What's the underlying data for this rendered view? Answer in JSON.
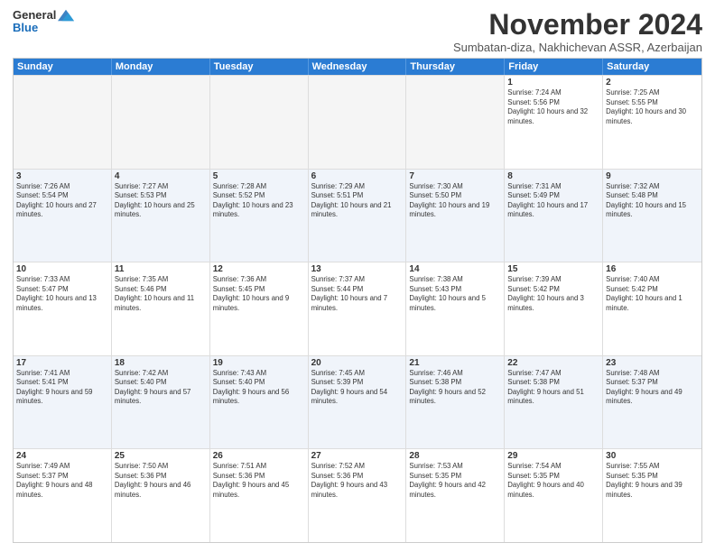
{
  "header": {
    "logo_line1": "General",
    "logo_line2": "Blue",
    "month_title": "November 2024",
    "subtitle": "Sumbatan-diza, Nakhichevan ASSR, Azerbaijan"
  },
  "days_of_week": [
    "Sunday",
    "Monday",
    "Tuesday",
    "Wednesday",
    "Thursday",
    "Friday",
    "Saturday"
  ],
  "weeks": [
    [
      {
        "day": "",
        "empty": true
      },
      {
        "day": "",
        "empty": true
      },
      {
        "day": "",
        "empty": true
      },
      {
        "day": "",
        "empty": true
      },
      {
        "day": "",
        "empty": true
      },
      {
        "day": "1",
        "sunrise": "7:24 AM",
        "sunset": "5:56 PM",
        "daylight": "10 hours and 32 minutes."
      },
      {
        "day": "2",
        "sunrise": "7:25 AM",
        "sunset": "5:55 PM",
        "daylight": "10 hours and 30 minutes."
      }
    ],
    [
      {
        "day": "3",
        "sunrise": "7:26 AM",
        "sunset": "5:54 PM",
        "daylight": "10 hours and 27 minutes."
      },
      {
        "day": "4",
        "sunrise": "7:27 AM",
        "sunset": "5:53 PM",
        "daylight": "10 hours and 25 minutes."
      },
      {
        "day": "5",
        "sunrise": "7:28 AM",
        "sunset": "5:52 PM",
        "daylight": "10 hours and 23 minutes."
      },
      {
        "day": "6",
        "sunrise": "7:29 AM",
        "sunset": "5:51 PM",
        "daylight": "10 hours and 21 minutes."
      },
      {
        "day": "7",
        "sunrise": "7:30 AM",
        "sunset": "5:50 PM",
        "daylight": "10 hours and 19 minutes."
      },
      {
        "day": "8",
        "sunrise": "7:31 AM",
        "sunset": "5:49 PM",
        "daylight": "10 hours and 17 minutes."
      },
      {
        "day": "9",
        "sunrise": "7:32 AM",
        "sunset": "5:48 PM",
        "daylight": "10 hours and 15 minutes."
      }
    ],
    [
      {
        "day": "10",
        "sunrise": "7:33 AM",
        "sunset": "5:47 PM",
        "daylight": "10 hours and 13 minutes."
      },
      {
        "day": "11",
        "sunrise": "7:35 AM",
        "sunset": "5:46 PM",
        "daylight": "10 hours and 11 minutes."
      },
      {
        "day": "12",
        "sunrise": "7:36 AM",
        "sunset": "5:45 PM",
        "daylight": "10 hours and 9 minutes."
      },
      {
        "day": "13",
        "sunrise": "7:37 AM",
        "sunset": "5:44 PM",
        "daylight": "10 hours and 7 minutes."
      },
      {
        "day": "14",
        "sunrise": "7:38 AM",
        "sunset": "5:43 PM",
        "daylight": "10 hours and 5 minutes."
      },
      {
        "day": "15",
        "sunrise": "7:39 AM",
        "sunset": "5:42 PM",
        "daylight": "10 hours and 3 minutes."
      },
      {
        "day": "16",
        "sunrise": "7:40 AM",
        "sunset": "5:42 PM",
        "daylight": "10 hours and 1 minute."
      }
    ],
    [
      {
        "day": "17",
        "sunrise": "7:41 AM",
        "sunset": "5:41 PM",
        "daylight": "9 hours and 59 minutes."
      },
      {
        "day": "18",
        "sunrise": "7:42 AM",
        "sunset": "5:40 PM",
        "daylight": "9 hours and 57 minutes."
      },
      {
        "day": "19",
        "sunrise": "7:43 AM",
        "sunset": "5:40 PM",
        "daylight": "9 hours and 56 minutes."
      },
      {
        "day": "20",
        "sunrise": "7:45 AM",
        "sunset": "5:39 PM",
        "daylight": "9 hours and 54 minutes."
      },
      {
        "day": "21",
        "sunrise": "7:46 AM",
        "sunset": "5:38 PM",
        "daylight": "9 hours and 52 minutes."
      },
      {
        "day": "22",
        "sunrise": "7:47 AM",
        "sunset": "5:38 PM",
        "daylight": "9 hours and 51 minutes."
      },
      {
        "day": "23",
        "sunrise": "7:48 AM",
        "sunset": "5:37 PM",
        "daylight": "9 hours and 49 minutes."
      }
    ],
    [
      {
        "day": "24",
        "sunrise": "7:49 AM",
        "sunset": "5:37 PM",
        "daylight": "9 hours and 48 minutes."
      },
      {
        "day": "25",
        "sunrise": "7:50 AM",
        "sunset": "5:36 PM",
        "daylight": "9 hours and 46 minutes."
      },
      {
        "day": "26",
        "sunrise": "7:51 AM",
        "sunset": "5:36 PM",
        "daylight": "9 hours and 45 minutes."
      },
      {
        "day": "27",
        "sunrise": "7:52 AM",
        "sunset": "5:36 PM",
        "daylight": "9 hours and 43 minutes."
      },
      {
        "day": "28",
        "sunrise": "7:53 AM",
        "sunset": "5:35 PM",
        "daylight": "9 hours and 42 minutes."
      },
      {
        "day": "29",
        "sunrise": "7:54 AM",
        "sunset": "5:35 PM",
        "daylight": "9 hours and 40 minutes."
      },
      {
        "day": "30",
        "sunrise": "7:55 AM",
        "sunset": "5:35 PM",
        "daylight": "9 hours and 39 minutes."
      }
    ]
  ],
  "labels": {
    "sunrise": "Sunrise:",
    "sunset": "Sunset:",
    "daylight": "Daylight:"
  }
}
